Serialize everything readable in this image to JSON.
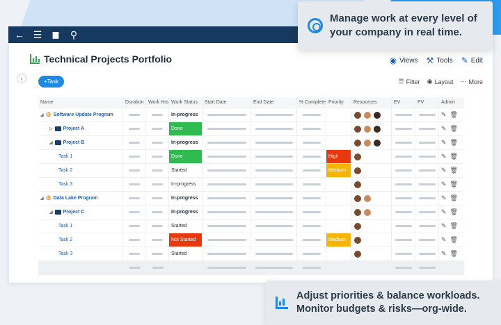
{
  "app": {
    "title": "Technical Projects Portfolio",
    "actions": {
      "views": "Views",
      "tools": "Tools",
      "edit": "Edit"
    },
    "task_button": "+Task",
    "toolbar": {
      "filter": "Filter",
      "layout": "Layout",
      "more": "More"
    }
  },
  "grid": {
    "columns": [
      "Name",
      "Duration",
      "Work Hrs",
      "Work Status",
      "Start Date",
      "End Date",
      "% Complete",
      "Priority",
      "Resources",
      "EV",
      "PV",
      "Admin"
    ],
    "rows": [
      {
        "name": "Software Update Program",
        "level": 0,
        "kind": "program",
        "status": "In-progress",
        "status_style": "bold",
        "priority": "",
        "priority_style": "",
        "resources": 3
      },
      {
        "name": "Project A",
        "level": 1,
        "kind": "project",
        "status": "Done",
        "status_style": "done",
        "priority": "",
        "priority_style": "",
        "resources": 3
      },
      {
        "name": "Project B",
        "level": 1,
        "kind": "project",
        "status": "In-progress",
        "status_style": "bold",
        "priority": "",
        "priority_style": "",
        "resources": 3
      },
      {
        "name": "Task 1",
        "level": 2,
        "kind": "task",
        "status": "Done",
        "status_style": "done",
        "priority": "High",
        "priority_style": "high",
        "resources": 1
      },
      {
        "name": "Task 2",
        "level": 2,
        "kind": "task",
        "status": "Started",
        "status_style": "plain",
        "priority": "Medium",
        "priority_style": "med",
        "resources": 1
      },
      {
        "name": "Task 3",
        "level": 2,
        "kind": "task",
        "status": "In-progress",
        "status_style": "plain",
        "priority": "",
        "priority_style": "",
        "resources": 1
      },
      {
        "name": "Data Lake Program",
        "level": 0,
        "kind": "program",
        "status": "In-progress",
        "status_style": "bold",
        "priority": "",
        "priority_style": "",
        "resources": 2
      },
      {
        "name": "Project C",
        "level": 1,
        "kind": "project",
        "status": "In-progress",
        "status_style": "bold",
        "priority": "",
        "priority_style": "",
        "resources": 2
      },
      {
        "name": "Task 1",
        "level": 2,
        "kind": "task",
        "status": "Started",
        "status_style": "plain",
        "priority": "",
        "priority_style": "",
        "resources": 1
      },
      {
        "name": "Task 2",
        "level": 2,
        "kind": "task",
        "status": "Not Started",
        "status_style": "notstarted",
        "priority": "Medium",
        "priority_style": "med",
        "resources": 1
      },
      {
        "name": "Task 3",
        "level": 2,
        "kind": "task",
        "status": "Started",
        "status_style": "plain",
        "priority": "",
        "priority_style": "",
        "resources": 1
      }
    ]
  },
  "callouts": {
    "top": "Manage work at every level of your company in real time.",
    "bottom": "Adjust priorities & balance workloads. Monitor budgets & risks—org-wide."
  },
  "colors": {
    "topbar": "#163a5f",
    "accent": "#1e88e5",
    "done": "#2fbb4f",
    "high": "#e8380d",
    "medium": "#f7b500",
    "link": "#1e5fb4"
  },
  "icons": {
    "topbar": [
      "back-arrow-icon",
      "menu-icon",
      "chart-icon",
      "search-icon"
    ],
    "header": [
      "eye-icon",
      "wrench-icon",
      "edit-icon"
    ],
    "admin": [
      "edit-icon",
      "trash-icon"
    ]
  }
}
